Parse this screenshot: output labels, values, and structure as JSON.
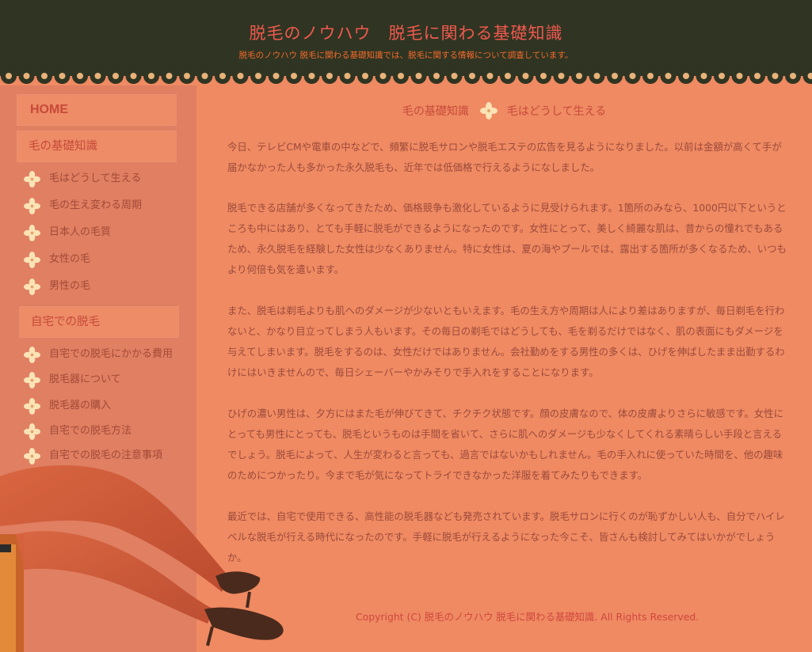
{
  "header": {
    "title": "脱毛のノウハウ　脱毛に関わる基礎知識",
    "subtitle": "脱毛のノウハウ 脱毛に関わる基礎知識では、脱毛に関する情報について調査しています。"
  },
  "colors": {
    "header_bg": "#2f3522",
    "page_bg": "#ef8a62",
    "sidebar_bg": "#e07f61",
    "accent": "#c74a3a",
    "text": "#9c4a3c"
  },
  "sidebar": {
    "home_label": "HOME",
    "sections": [
      {
        "heading": "毛の基礎知識",
        "items": [
          {
            "label": "毛はどうして生える",
            "icon": "flower-icon"
          },
          {
            "label": "毛の生え変わる周期",
            "icon": "flower-icon"
          },
          {
            "label": "日本人の毛質",
            "icon": "flower-icon"
          },
          {
            "label": "女性の毛",
            "icon": "flower-icon"
          },
          {
            "label": "男性の毛",
            "icon": "flower-icon"
          }
        ]
      },
      {
        "heading": "自宅での脱毛",
        "items": [
          {
            "label": "自宅での脱毛にかかる費用",
            "icon": "flower-icon"
          },
          {
            "label": "脱毛器について",
            "icon": "flower-icon"
          },
          {
            "label": "脱毛器の購入",
            "icon": "flower-icon"
          },
          {
            "label": "自宅での脱毛方法",
            "icon": "flower-icon"
          },
          {
            "label": "自宅での脱毛の注意事項",
            "icon": "flower-icon"
          }
        ]
      }
    ]
  },
  "breadcrumb": {
    "parent": "毛の基礎知識",
    "current": "毛はどうして生える"
  },
  "content": {
    "paragraphs": [
      "今日、テレビCMや電車の中などで、頻繁に脱毛サロンや脱毛エステの広告を見るようになりました。以前は金額が高くて手が届かなかった人も多かった永久脱毛も、近年では低価格で行えるようになしました。",
      "脱毛できる店舗が多くなってきたため、価格競争も激化しているように見受けられます。1箇所のみなら、1000円以下というところも中にはあり、とても手軽に脱毛ができるようになったのです。女性にとって、美しく綺麗な肌は、昔からの憧れでもあるため、永久脱毛を経験した女性は少なくありません。特に女性は、夏の海やプールでは、露出する箇所が多くなるため、いつもより何倍も気を遣います。",
      "また、脱毛は剃毛よりも肌へのダメージが少ないともいえます。毛の生え方や周期は人により差はありますが、毎日剃毛を行わないと、かなり目立ってしまう人もいます。その毎日の剃毛ではどうしても、毛を剃るだけではなく、肌の表面にもダメージを与えてしまいます。脱毛をするのは、女性だけではありません。会社勤めをする男性の多くは、ひげを伸ばしたまま出勤するわけにはいきませんので、毎日シェーバーやかみそりで手入れをすることになります。",
      "ひげの濃い男性は、夕方にはまた毛が伸びてきて、チクチク状態です。顔の皮膚なので、体の皮膚よりさらに敏感です。女性にとっても男性にとっても、脱毛というものは手間を省いて、さらに肌へのダメージも少なくしてくれる素晴らしい手段と言えるでしょう。脱毛によって、人生が変わると言っても、過言ではないかもしれません。毛の手入れに使っていた時間を、他の趣味のためにつかったり。今まで毛が気になってトライできなかった洋服を着てみたりもできます。",
      "最近では、自宅で使用できる、高性能の脱毛器なども発売されています。脱毛サロンに行くのが恥ずかしい人も、自分でハイレベルな脱毛が行える時代になったのです。手軽に脱毛が行えるようになった今こそ、皆さんも検討してみてはいかがでしょうか。"
    ]
  },
  "footer": {
    "copyright": "Copyright (C) 脱毛のノウハウ 脱毛に関わる基礎知識. All Rights Reserved."
  }
}
